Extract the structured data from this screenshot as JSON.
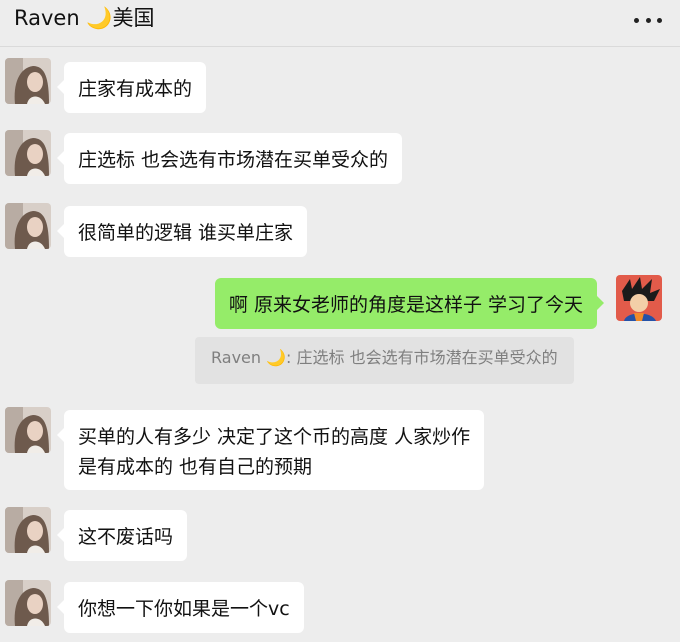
{
  "header": {
    "title": "Raven 🌙美国",
    "more_icon": "more-dots-icon"
  },
  "messages": [
    {
      "sender": "Raven",
      "text": "庄家有成本的"
    },
    {
      "sender": "Raven",
      "text": "庄选标 也会选有市场潜在买单受众的"
    },
    {
      "sender": "Raven",
      "text": "很简单的逻辑 谁买单庄家"
    },
    {
      "sender": "me",
      "text": "啊 原来女老师的角度是这样子 学习了今天"
    },
    {
      "sender": "quote",
      "text": "Raven 🌙: 庄选标 也会选有市场潜在买单受众的"
    },
    {
      "sender": "Raven",
      "lines": [
        "买单的人有多少 决定了这个币的高度  人家炒作",
        "是有成本的 也有自己的预期"
      ]
    },
    {
      "sender": "Raven",
      "text": "这不废话吗"
    },
    {
      "sender": "Raven",
      "text": "你想一下你如果是一个vc"
    }
  ],
  "colors": {
    "background": "#ededed",
    "incoming_bubble": "#ffffff",
    "outgoing_bubble": "#95ec69",
    "quote_bubble": "#e2e2e2"
  }
}
